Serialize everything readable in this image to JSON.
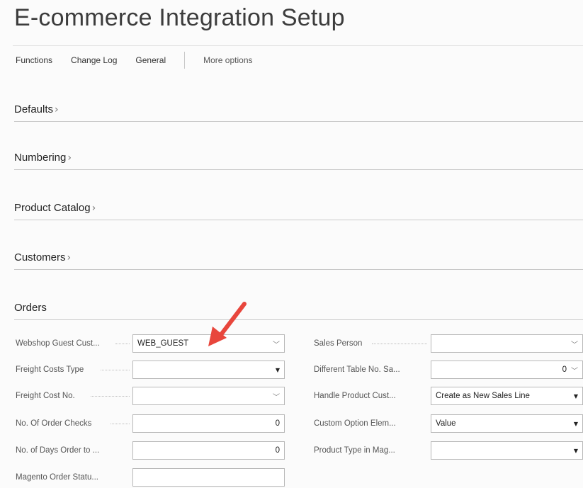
{
  "page": {
    "title": "E-commerce Integration Setup"
  },
  "actions": [
    "Functions",
    "Change Log",
    "General"
  ],
  "more_options": "More options",
  "fasttabs": {
    "defaults": "Defaults",
    "numbering": "Numbering",
    "product_catalog": "Product Catalog",
    "customers": "Customers",
    "orders": "Orders"
  },
  "orders": {
    "left": [
      {
        "label": "Webshop Guest Cust...",
        "value": "WEB_GUEST",
        "kind": "lookup"
      },
      {
        "label": "Freight Costs Type",
        "value": "",
        "kind": "select"
      },
      {
        "label": "Freight Cost No.",
        "value": "",
        "kind": "lookup"
      },
      {
        "label": "No. Of Order Checks",
        "value": "0",
        "kind": "number"
      },
      {
        "label": "No. of Days Order to ...",
        "value": "0",
        "kind": "number"
      },
      {
        "label": "Magento Order Statu...",
        "value": "",
        "kind": "text"
      }
    ],
    "right": [
      {
        "label": "Sales Person",
        "value": "",
        "kind": "lookup"
      },
      {
        "label": "Different Table No. Sa...",
        "value": "0",
        "kind": "number-lookup"
      },
      {
        "label": "Handle Product Cust...",
        "value": "Create as New Sales Line",
        "kind": "select"
      },
      {
        "label": "Custom Option Elem...",
        "value": "Value",
        "kind": "select"
      },
      {
        "label": "Product Type in Mag...",
        "value": "",
        "kind": "select"
      }
    ]
  },
  "colors": {
    "arrow": "#e8463c",
    "rule": "#c9c9c9",
    "field_border": "#b8b8b8"
  },
  "icons": {
    "chevron_right": "chevron-right-icon",
    "lookup": "chevron-down-icon",
    "select": "triangle-down-icon"
  }
}
